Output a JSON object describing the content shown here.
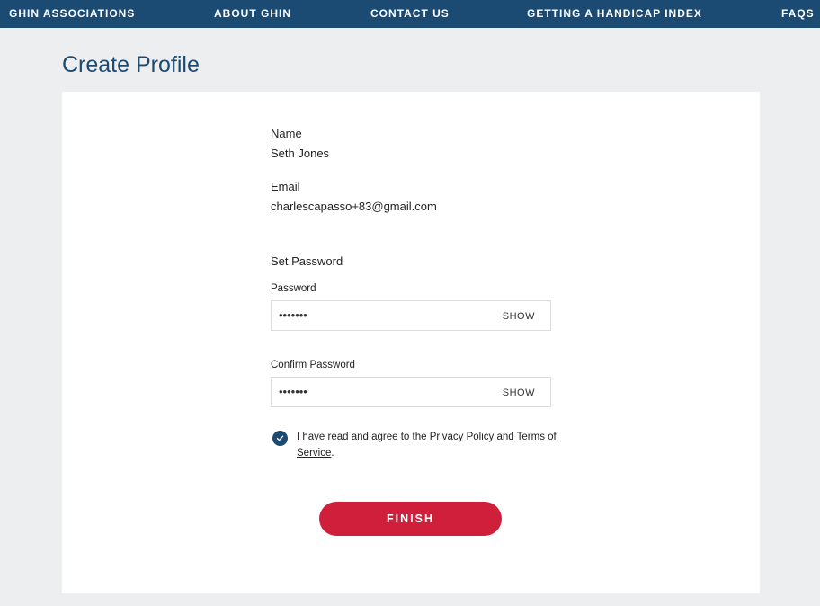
{
  "nav": {
    "items": [
      {
        "label": "GHIN ASSOCIATIONS"
      },
      {
        "label": "ABOUT GHIN"
      },
      {
        "label": "CONTACT US"
      },
      {
        "label": "GETTING A HANDICAP INDEX"
      },
      {
        "label": "FAQS"
      }
    ]
  },
  "page": {
    "title": "Create Profile"
  },
  "profile": {
    "name_label": "Name",
    "name_value": "Seth Jones",
    "email_label": "Email",
    "email_value": "charlescapasso+83@gmail.com"
  },
  "password": {
    "section_title": "Set Password",
    "password_label": "Password",
    "password_masked": "•••••••",
    "confirm_label": "Confirm Password",
    "confirm_masked": "•••••••",
    "show_label": "SHOW"
  },
  "agreement": {
    "checked": true,
    "text_before": "I have read and agree to the ",
    "privacy_link": "Privacy Policy",
    "text_middle": " and ",
    "terms_link": "Terms of Service",
    "text_after": "."
  },
  "finish_label": "FINISH",
  "colors": {
    "nav_bg": "#1b4a73",
    "accent_red": "#cf1f3b",
    "page_bg": "#edeeef"
  }
}
